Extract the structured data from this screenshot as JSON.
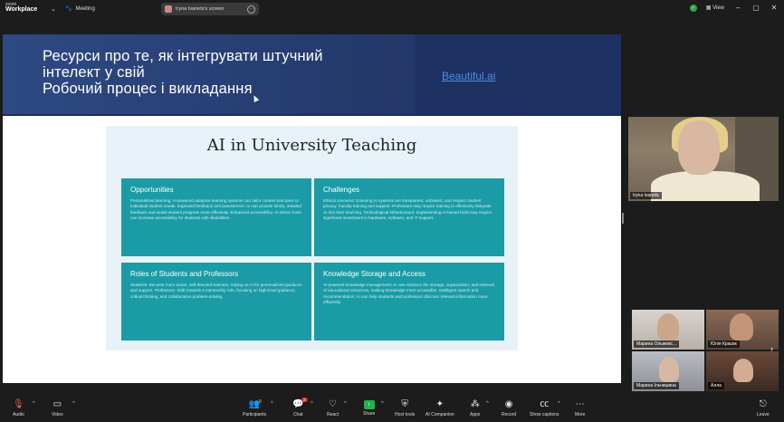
{
  "app": {
    "brand_line1": "zoom",
    "brand_line2": "Workplace",
    "meeting_label": "Meeting"
  },
  "share_pill": {
    "label": "Iryna Ivanets's screen"
  },
  "window": {
    "view_label": "View"
  },
  "slide": {
    "title_line1": "Ресурси про те, як інтегрувати штучний",
    "title_line2": "інтелект у свій",
    "title_line3": "Робочий процес і викладання",
    "link_text": "Beautiful.ai",
    "infographic_title": "AI in University Teaching",
    "cards": [
      {
        "heading": "Opportunities",
        "body": "Personalized learning: AI-powered adaptive learning systems can tailor content and pace to individual student needs. Improved feedback and assessment: AI can provide timely, detailed feedback and assist student progress more efficiently. Enhanced accessibility: AI-driven tools can increase accessibility for students with disabilities."
      },
      {
        "heading": "Challenges",
        "body": "Ethical concerns: Ensuring AI systems are transparent, unbiased, and respect student privacy. Faculty training and support: Professors may require training to effectively integrate AI into their teaching. Technological infrastructure: Implementing AI-based tools may require significant investment in hardware, software, and IT support."
      },
      {
        "heading": "Roles of Students and Professors",
        "body": "Students: Become more active, self-directed learners, relying on AI for personalized guidance and support. Professors: Shift towards a mentorship role, focusing on high-level guidance, critical thinking, and collaborative problem-solving."
      },
      {
        "heading": "Knowledge Storage and Access",
        "body": "AI-powered knowledge management: AI can enhance the storage, organization, and retrieval of educational resources, making knowledge more accessible. Intelligent search and recommendation: AI can help students and professors discover relevant information more efficiently."
      }
    ]
  },
  "participants": {
    "main": {
      "name": "Iryna Ivanets"
    },
    "tiles": [
      {
        "name": "Марина Ольжевс..."
      },
      {
        "name": "Юлія Краєвк"
      },
      {
        "name": "Марина Ільчишина"
      },
      {
        "name": "Алла"
      }
    ]
  },
  "toolbar": {
    "audio": "Audio",
    "video": "Video",
    "participants": "Participants",
    "participants_count": "8",
    "chat": "Chat",
    "chat_badge": "2",
    "react": "React",
    "share": "Share",
    "host_tools": "Host tools",
    "ai_companion": "AI Companion",
    "apps": "Apps",
    "record": "Record",
    "captions": "Show captions",
    "more": "More",
    "leave": "Leave"
  }
}
